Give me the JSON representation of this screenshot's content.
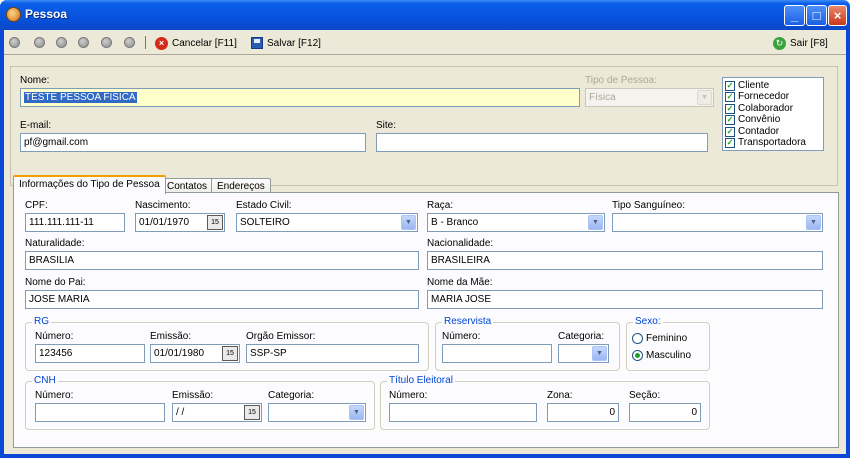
{
  "window": {
    "title": "Pessoa"
  },
  "toolbar": {
    "nav": [
      "first-icon",
      "prev-page-icon",
      "prev-icon",
      "next-icon",
      "next-page-icon",
      "last-icon"
    ],
    "cancel_label": "Cancelar [F11]",
    "save_label": "Salvar [F12]",
    "exit_label": "Sair [F8]"
  },
  "header": {
    "nome_label": "Nome:",
    "nome_value": "TESTE PESSOA FISICA",
    "tipo_label": "Tipo de Pessoa:",
    "tipo_value": "Física",
    "email_label": "E-mail:",
    "email_value": "pf@gmail.com",
    "site_label": "Site:",
    "site_value": ""
  },
  "roles": [
    {
      "label": "Cliente",
      "checked": true
    },
    {
      "label": "Fornecedor",
      "checked": true
    },
    {
      "label": "Colaborador",
      "checked": true
    },
    {
      "label": "Convênio",
      "checked": true
    },
    {
      "label": "Contador",
      "checked": true
    },
    {
      "label": "Transportadora",
      "checked": true
    }
  ],
  "tabs": [
    "Informações do Tipo de Pessoa",
    "Contatos",
    "Endereços"
  ],
  "form": {
    "cpf_label": "CPF:",
    "cpf": "111.111.111-11",
    "nasc_label": "Nascimento:",
    "nasc": "01/01/1970",
    "civil_label": "Estado Civil:",
    "civil": "SOLTEIRO",
    "raca_label": "Raça:",
    "raca": "B - Branco",
    "sangue_label": "Tipo Sanguíneo:",
    "sangue": "",
    "natural_label": "Naturalidade:",
    "natural": "BRASILIA",
    "nacional_label": "Nacionalidade:",
    "nacional": "BRASILEIRA",
    "pai_label": "Nome do Pai:",
    "pai": "JOSE MARIA",
    "mae_label": "Nome da Mãe:",
    "mae": "MARIA JOSE",
    "rg": {
      "title": "RG",
      "numero_label": "Número:",
      "numero": "123456",
      "emissao_label": "Emissão:",
      "emissao": "01/01/1980",
      "orgao_label": "Orgão Emissor:",
      "orgao": "SSP-SP"
    },
    "reservista": {
      "title": "Reservista",
      "numero_label": "Número:",
      "numero": "",
      "categoria_label": "Categoria:",
      "categoria": ""
    },
    "sexo": {
      "title": "Sexo:",
      "options": [
        "Feminino",
        "Masculino"
      ],
      "selected": "Masculino"
    },
    "cnh": {
      "title": "CNH",
      "numero_label": "Número:",
      "numero": "",
      "emissao_label": "Emissão:",
      "emissao": " / /",
      "categoria_label": "Categoria:",
      "categoria": ""
    },
    "titulo": {
      "title": "Título Eleitoral",
      "numero_label": "Número:",
      "numero": "",
      "zona_label": "Zona:",
      "zona": "0",
      "secao_label": "Seção:",
      "secao": "0"
    }
  }
}
